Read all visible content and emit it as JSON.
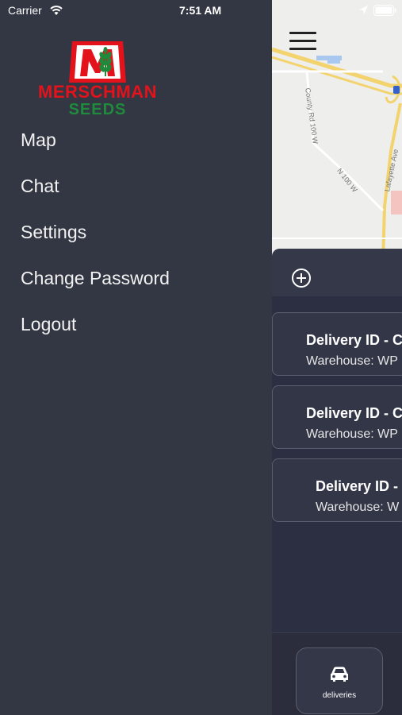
{
  "status_bar": {
    "carrier": "Carrier",
    "time": "7:51 AM"
  },
  "logo": {
    "wordmark": "MERSCHMAN",
    "subtitle": "SEEDS",
    "emblem_letter": "M",
    "colors": {
      "red": "#e3121b",
      "green": "#1f8a3c"
    }
  },
  "side_menu": {
    "items": [
      {
        "label": "Map"
      },
      {
        "label": "Chat"
      },
      {
        "label": "Settings"
      },
      {
        "label": "Change Password"
      },
      {
        "label": "Logout"
      }
    ]
  },
  "map": {
    "labels": {
      "road1": "County Rd 100 W",
      "road2": "N 100 W",
      "road3": "Lafayette Ave"
    }
  },
  "deliveries": {
    "cards": [
      {
        "title": "Delivery ID - C",
        "subtitle": "Warehouse: WP"
      },
      {
        "title": "Delivery ID - C",
        "subtitle": "Warehouse: WP"
      },
      {
        "title": "Delivery ID -",
        "subtitle": "Warehouse: W"
      }
    ]
  },
  "tab_bar": {
    "deliveries_label": "deliveries"
  },
  "theme": {
    "menu_bg": "#333743",
    "sheet_bg": "#2c2f41",
    "card_bg": "#333647"
  }
}
